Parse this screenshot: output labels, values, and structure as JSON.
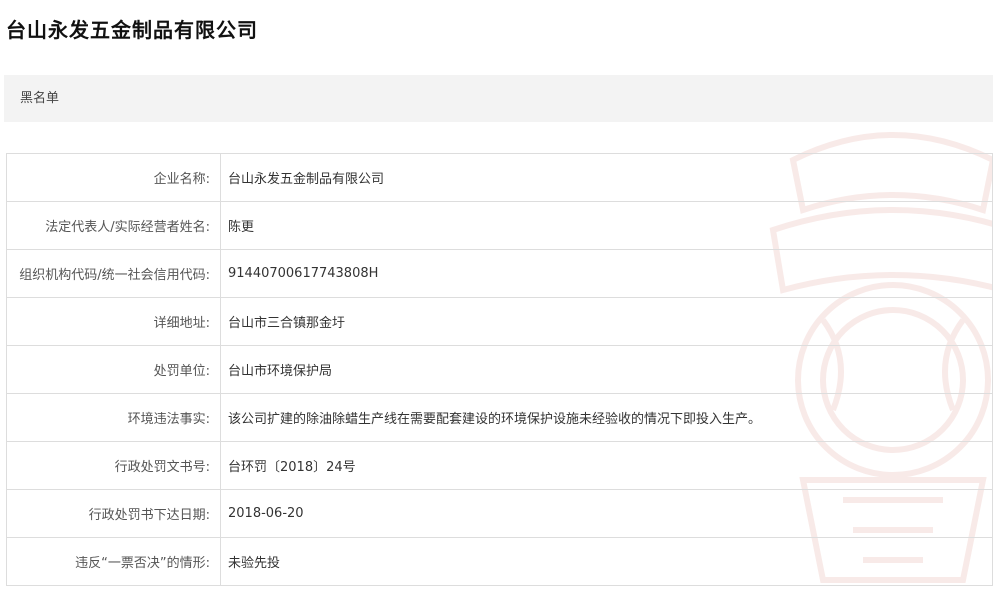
{
  "page": {
    "title": "台山永发五金制品有限公司",
    "category": "黑名单"
  },
  "details": [
    {
      "label": "企业名称:",
      "value": "台山永发五金制品有限公司"
    },
    {
      "label": "法定代表人/实际经营者姓名:",
      "value": "陈更"
    },
    {
      "label": "组织机构代码/统一社会信用代码:",
      "value": "91440700617743808H"
    },
    {
      "label": "详细地址:",
      "value": "台山市三合镇那金圩"
    },
    {
      "label": "处罚单位:",
      "value": "台山市环境保护局"
    },
    {
      "label": "环境违法事实:",
      "value": "该公司扩建的除油除蜡生产线在需要配套建设的环境保护设施未经验收的情况下即投入生产。"
    },
    {
      "label": "行政处罚文书号:",
      "value": "台环罚〔2018〕24号"
    },
    {
      "label": "行政处罚书下达日期:",
      "value": "2018-06-20"
    },
    {
      "label": "违反“一票否决”的情形:",
      "value": "未验先投"
    }
  ],
  "colors": {
    "category_bar_bg": "#f3f3f3",
    "table_border": "#dddddd",
    "watermark": "#c0392b"
  }
}
